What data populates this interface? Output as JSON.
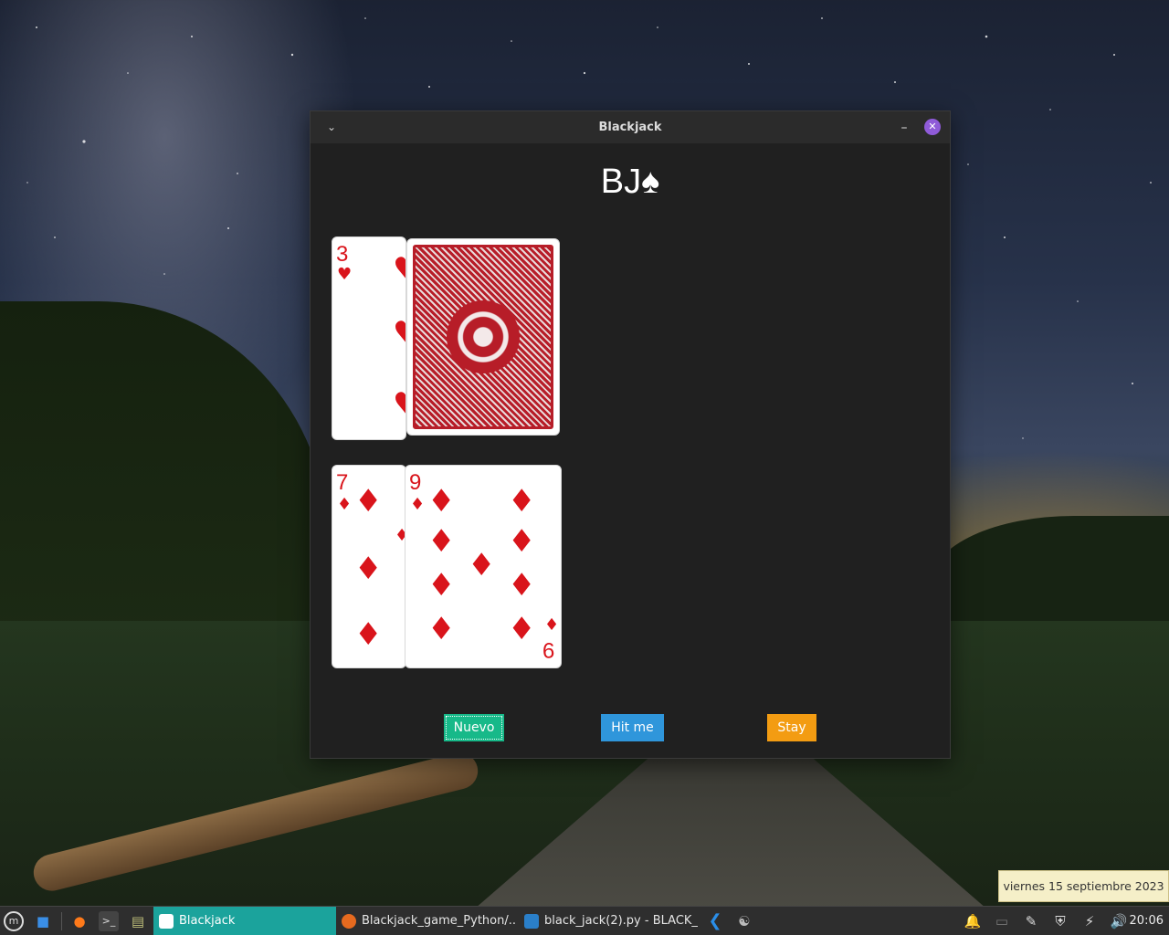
{
  "window": {
    "title": "Blackjack",
    "menu_icon": "chevron-down-icon",
    "minimize_label": "–",
    "close_label": "✕"
  },
  "app": {
    "logo_text": "BJ♠"
  },
  "dealer_cards": [
    {
      "rank": "3",
      "suit": "♥",
      "face": "up"
    },
    {
      "face": "down"
    }
  ],
  "player_cards": [
    {
      "rank": "7",
      "suit": "♦",
      "face": "up"
    },
    {
      "rank": "9",
      "suit": "♦",
      "face": "up"
    }
  ],
  "buttons": {
    "nuevo": "Nuevo",
    "hit": "Hit me",
    "stay": "Stay"
  },
  "colors": {
    "nuevo": "#17b989",
    "hit": "#2f96db",
    "stay": "#f39c12",
    "card_red": "#d9141b",
    "close_button": "#8f5bd8"
  },
  "tooltip": {
    "date": "viernes 15 septiembre 2023"
  },
  "taskbar": {
    "active_task": "Blackjack",
    "task2": "Blackjack_game_Python/...",
    "task3": "black_jack(2).py - BLACK_...",
    "clock": "20:06",
    "icons": [
      "mint-menu-icon",
      "show-desktop-icon",
      "firefox-icon",
      "terminal-icon",
      "files-icon",
      "vscode-icon",
      "database-icon",
      "bell-icon",
      "clipboard-icon",
      "shield-icon",
      "battery-icon",
      "volume-icon"
    ]
  }
}
